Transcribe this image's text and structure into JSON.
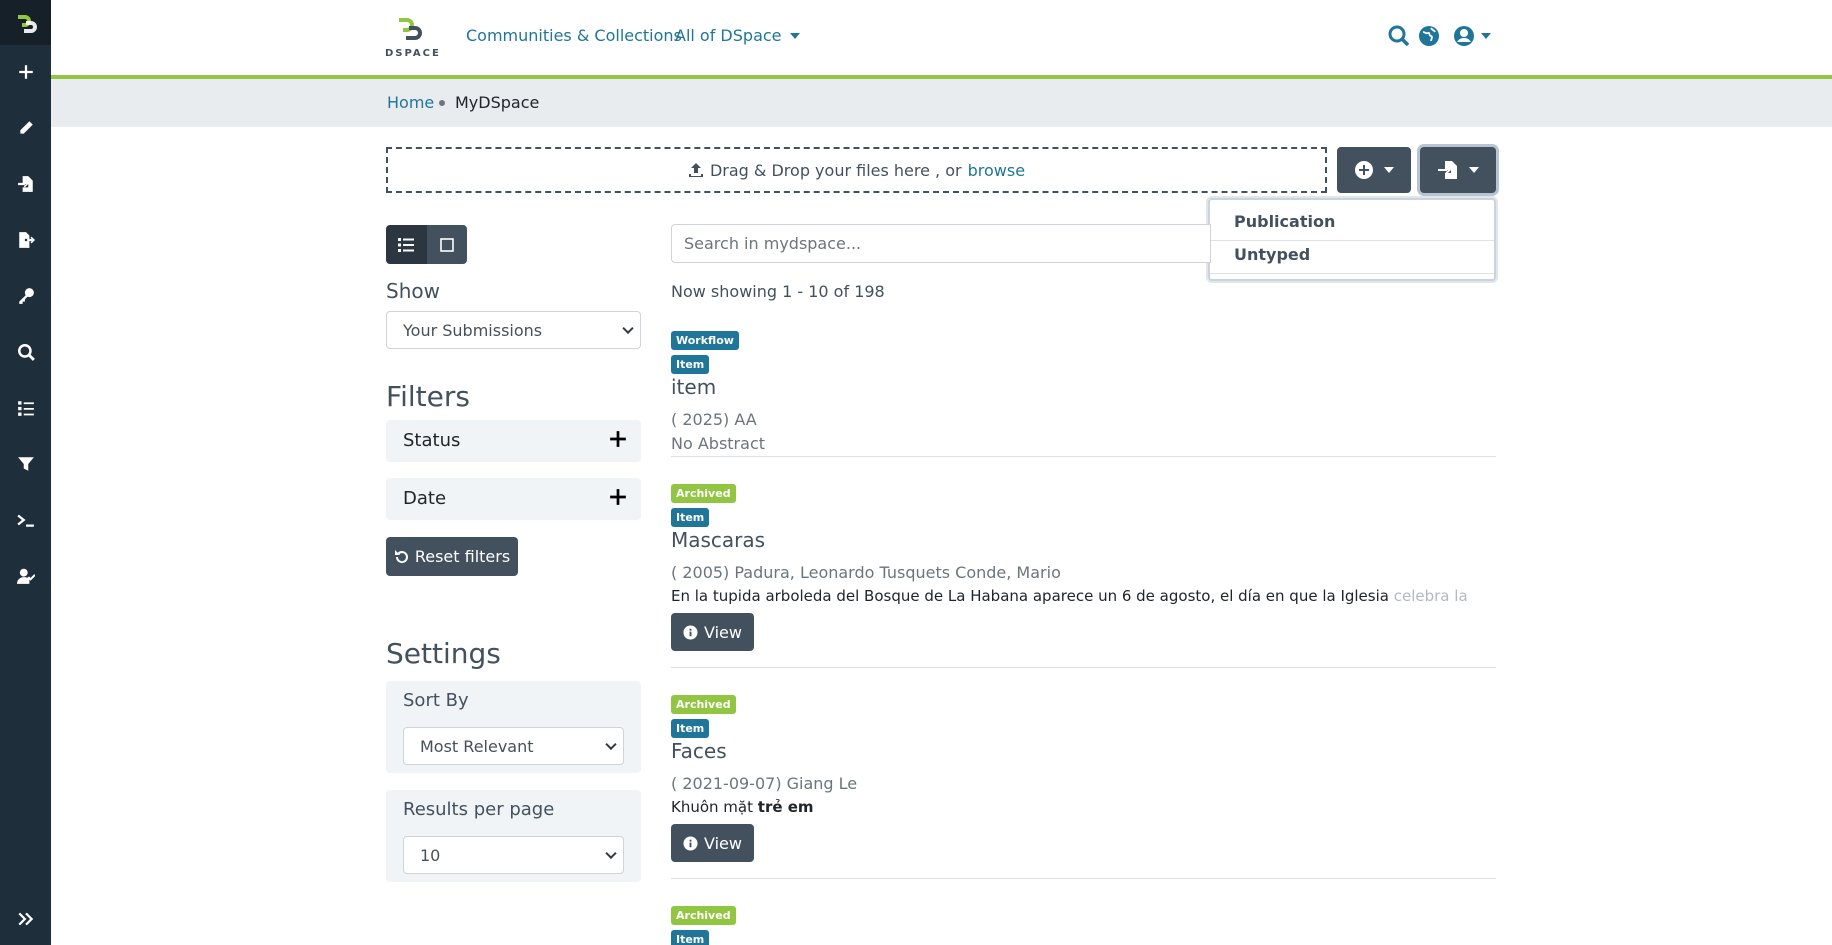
{
  "brand": {
    "logo_text": "DSPACE"
  },
  "nav": {
    "communities": "Communities & Collections",
    "all_of_dspace": "All of DSpace"
  },
  "breadcrumb": {
    "home": "Home",
    "current": "MyDSpace"
  },
  "upload": {
    "drag_text": "Drag & Drop your files here , or",
    "browse": "browse"
  },
  "import_menu": {
    "items": [
      "Publication",
      "Untyped"
    ]
  },
  "search": {
    "placeholder": "Search in mydspace..."
  },
  "show": {
    "label": "Show",
    "selected": "Your Submissions"
  },
  "filters": {
    "title": "Filters",
    "facets": [
      "Status",
      "Date"
    ],
    "reset": "Reset filters"
  },
  "settings": {
    "title": "Settings",
    "sort_label": "Sort By",
    "sort_value": "Most Relevant",
    "rpp_label": "Results per page",
    "rpp_value": "10"
  },
  "results": {
    "showing": "Now showing 1 - 10 of 198",
    "view_label": "View",
    "items": [
      {
        "status": "Workflow",
        "type": "Item",
        "title": "item",
        "meta": "( 2025) AA",
        "abstract": "No Abstract"
      },
      {
        "status": "Archived",
        "type": "Item",
        "title": "Mascaras",
        "meta": "( 2005) Padura, Leonardo Tusquets Conde, Mario",
        "abstract": "En la tupida arboleda del Bosque de La Habana aparece un 6 de agosto, el día en que la Iglesia",
        "abstract_fade": "celebra la"
      },
      {
        "status": "Archived",
        "type": "Item",
        "title": "Faces",
        "meta": "( 2021-09-07) Giang Le",
        "abstract": "Khuôn mặt",
        "abstract_bold": "trẻ em"
      },
      {
        "status": "Archived",
        "type": "Item"
      }
    ]
  },
  "colors": {
    "sidebar": "#1f2e3b",
    "accent_green": "#92c642",
    "link_blue": "#207698",
    "button_dark": "#43515f"
  },
  "icons": [
    "dspace-logo-icon",
    "plus-icon",
    "pencil-icon",
    "file-import-icon",
    "file-export-icon",
    "key-icon",
    "search-icon",
    "list-icon",
    "filter-icon",
    "terminal-icon",
    "user-check-icon",
    "expand-icon",
    "globe-icon",
    "user-circle-icon"
  ]
}
